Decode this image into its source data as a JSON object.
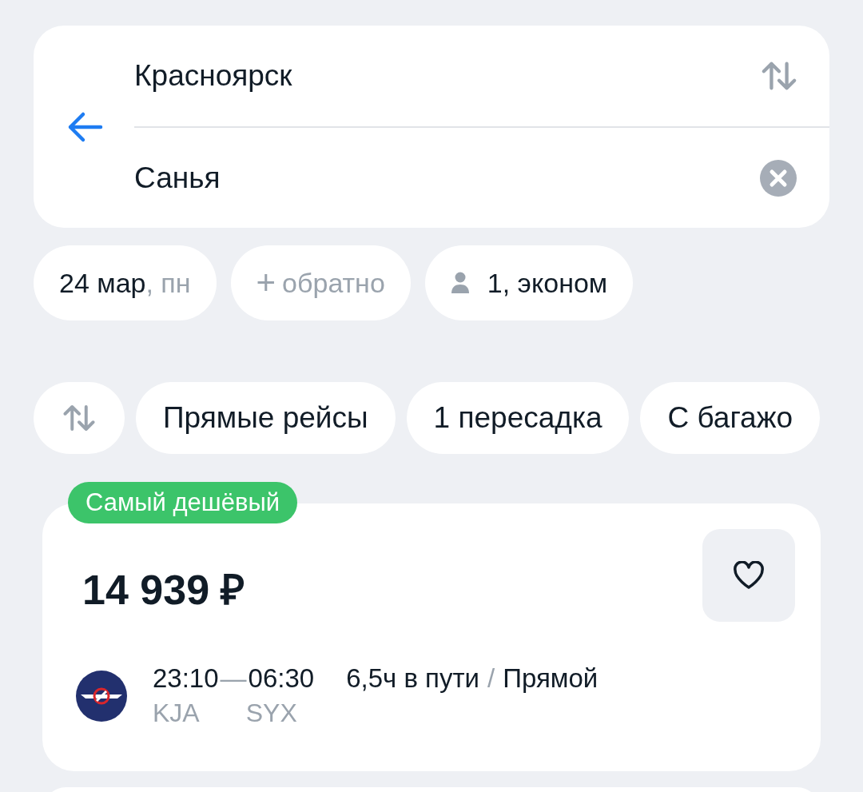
{
  "route": {
    "origin": "Красноярск",
    "destination": "Санья"
  },
  "chips": [
    {
      "kind": "date",
      "label": "24 мар",
      "suffix": ", пн"
    },
    {
      "kind": "add",
      "icon": "+",
      "label": "обратно"
    },
    {
      "kind": "passengers",
      "label": "1, эконом"
    }
  ],
  "filters": [
    {
      "label": "Прямые рейсы",
      "selected": false
    },
    {
      "label": "1 пересадка",
      "selected": false
    },
    {
      "label": "С багажо",
      "selected": false
    }
  ],
  "offer": {
    "badge": "Самый дешёвый",
    "price": "14 939 ₽",
    "departure": "23:10",
    "dash": "—",
    "arrival": "06:30",
    "from_code": "KJA",
    "to_code": "SYX",
    "duration": "6,5ч в пути",
    "separator": "/",
    "stops": "Прямой"
  }
}
